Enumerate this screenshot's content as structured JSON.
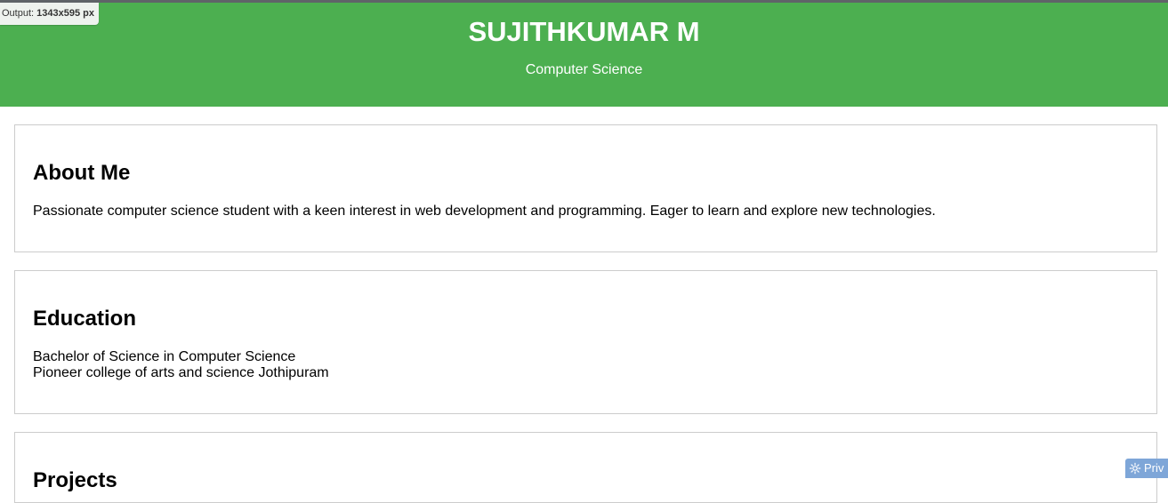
{
  "output_badge": {
    "label": "Output:",
    "size": "1343x595 px"
  },
  "header": {
    "name": "SUJITHKUMAR M",
    "subtitle": "Computer Science",
    "bg_color": "#4caf50"
  },
  "about": {
    "title": "About Me",
    "text": "Passionate computer science student with a keen interest in web development and programming. Eager to learn and explore new technologies."
  },
  "education": {
    "title": "Education",
    "line1": "Bachelor of Science in Computer Science",
    "line2": "Pioneer college of arts and science Jothipuram"
  },
  "projects": {
    "title": "Projects"
  },
  "privacy": {
    "icon": "gear-icon",
    "label": "Priv"
  }
}
